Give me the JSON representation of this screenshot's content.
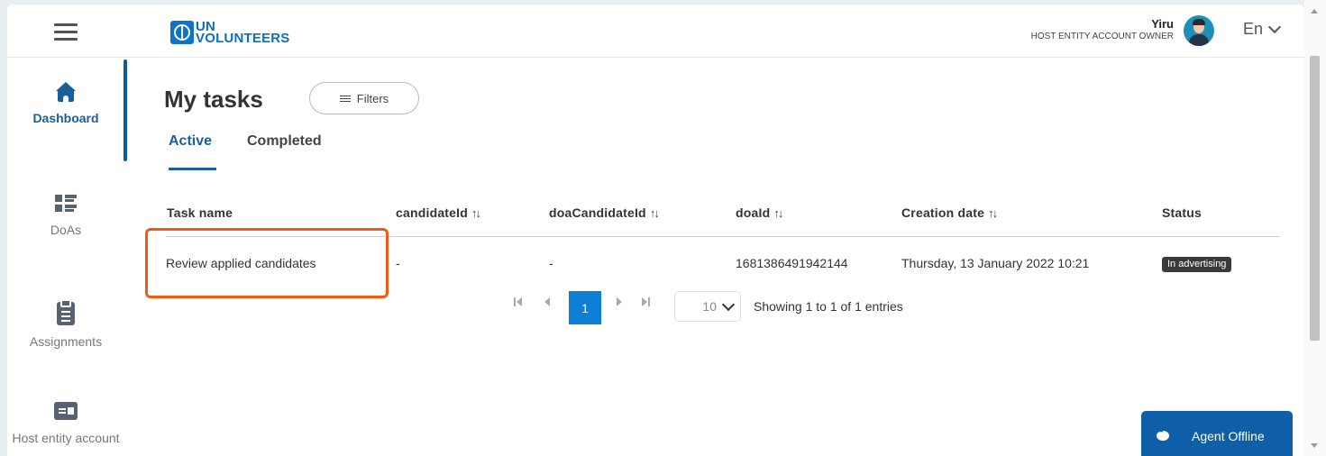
{
  "header": {
    "logo_line1": "UN",
    "logo_line2": "VOLUNTEERS",
    "user_name": "Yiru",
    "user_role": "HOST ENTITY ACCOUNT OWNER",
    "language": "En"
  },
  "sidebar": {
    "items": [
      {
        "label": "Dashboard",
        "icon": "home-icon"
      },
      {
        "label": "DoAs",
        "icon": "list-icon"
      },
      {
        "label": "Assignments",
        "icon": "clipboard-icon"
      },
      {
        "label": "Host entity account",
        "icon": "id-card-icon"
      }
    ]
  },
  "main": {
    "title": "My tasks",
    "filters_label": "Filters",
    "tabs": [
      {
        "label": "Active",
        "active": true
      },
      {
        "label": "Completed",
        "active": false
      }
    ]
  },
  "table": {
    "sort_glyph": "↑↓",
    "columns": [
      "Task name",
      "candidateId",
      "doaCandidateId",
      "doaId",
      "Creation date",
      "Status"
    ],
    "rows": [
      {
        "task_name": "Review applied candidates",
        "candidateId": "-",
        "doaCandidateId": "-",
        "doaId": "1681386491942144",
        "creation_date": "Thursday, 13 January 2022 10:21",
        "status": "In advertising"
      }
    ]
  },
  "pagination": {
    "current_page": "1",
    "page_size": "10",
    "info": "Showing 1 to 1 of 1 entries"
  },
  "chat": {
    "label": "Agent Offline"
  },
  "colors": {
    "brand": "#0d6ec2",
    "highlight": "#f05a14",
    "chat": "#0f5fa8"
  }
}
